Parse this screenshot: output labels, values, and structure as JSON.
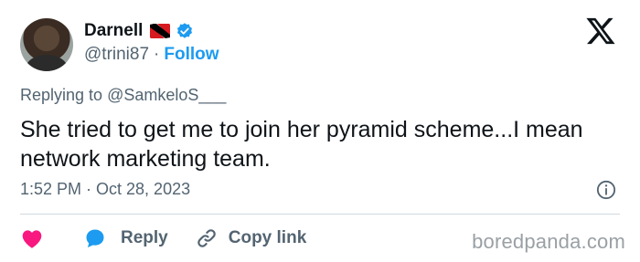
{
  "author": {
    "name": "Darnell",
    "handle": "@trini87",
    "separator": "·",
    "follow_label": "Follow",
    "flag": "trinidad-and-tobago-flag",
    "verified": true
  },
  "reply_context": {
    "prefix": "Replying to",
    "mention": "@SamkeloS___"
  },
  "tweet": {
    "text": "She tried to get me to join her pyramid scheme...I mean network marketing team.",
    "timestamp": "1:52 PM · Oct 28, 2023"
  },
  "actions": {
    "reply_label": "Reply",
    "copy_label": "Copy link"
  },
  "watermark": "boredpanda.com",
  "colors": {
    "accent": "#1d9bf0",
    "heart": "#f91880",
    "muted": "#536471",
    "text": "#0f1419"
  },
  "icons": [
    "x-logo-icon",
    "verified-badge-icon",
    "info-icon",
    "heart-icon",
    "reply-bubble-icon",
    "link-icon"
  ]
}
